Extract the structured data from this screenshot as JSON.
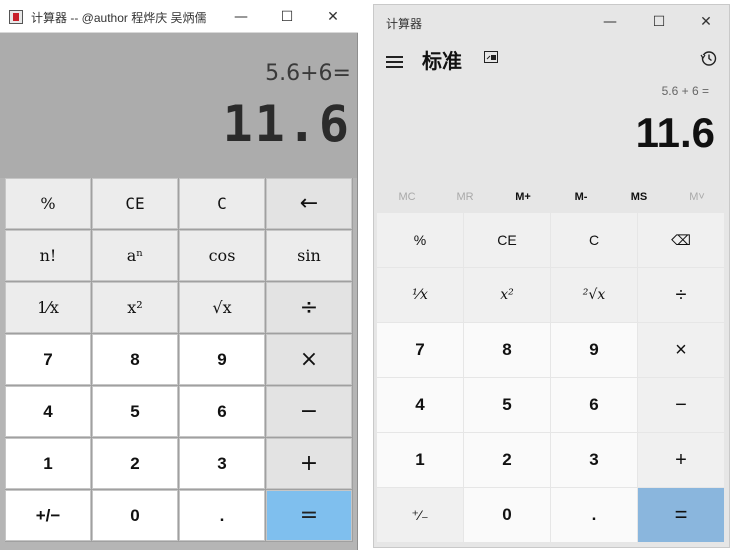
{
  "left_window": {
    "title": "计算器 -- @author 程烨庆 吴炳儒",
    "display": {
      "expression": "5.6+6=",
      "result": "11.6"
    },
    "buttons": [
      {
        "label": "%",
        "kind": "func"
      },
      {
        "label": "CE",
        "kind": "mono"
      },
      {
        "label": "C",
        "kind": "mono"
      },
      {
        "label": "←",
        "kind": "op"
      },
      {
        "label": "n!",
        "kind": "func"
      },
      {
        "label": "aⁿ",
        "kind": "func"
      },
      {
        "label": "cos",
        "kind": "func"
      },
      {
        "label": "sin",
        "kind": "func"
      },
      {
        "label": "1⁄x",
        "kind": "func"
      },
      {
        "label": "x²",
        "kind": "func"
      },
      {
        "label": "√x",
        "kind": "func"
      },
      {
        "label": "÷",
        "kind": "op"
      },
      {
        "label": "7",
        "kind": "num"
      },
      {
        "label": "8",
        "kind": "num"
      },
      {
        "label": "9",
        "kind": "num"
      },
      {
        "label": "×",
        "kind": "op"
      },
      {
        "label": "4",
        "kind": "num"
      },
      {
        "label": "5",
        "kind": "num"
      },
      {
        "label": "6",
        "kind": "num"
      },
      {
        "label": "−",
        "kind": "op"
      },
      {
        "label": "1",
        "kind": "num"
      },
      {
        "label": "2",
        "kind": "num"
      },
      {
        "label": "3",
        "kind": "num"
      },
      {
        "label": "+",
        "kind": "op"
      },
      {
        "label": "+/−",
        "kind": "num"
      },
      {
        "label": "0",
        "kind": "num"
      },
      {
        "label": ".",
        "kind": "num"
      },
      {
        "label": "=",
        "kind": "eq"
      }
    ]
  },
  "right_window": {
    "title": "计算器",
    "mode": "标准",
    "display": {
      "expression": "5.6 + 6 =",
      "result": "11.6"
    },
    "memory": [
      {
        "label": "MC",
        "disabled": true
      },
      {
        "label": "MR",
        "disabled": true
      },
      {
        "label": "M+",
        "disabled": false
      },
      {
        "label": "M-",
        "disabled": false
      },
      {
        "label": "MS",
        "disabled": false
      },
      {
        "label": "M˅",
        "disabled": true
      }
    ],
    "buttons": [
      {
        "label": "%",
        "kind": "op-small"
      },
      {
        "label": "CE",
        "kind": "plain"
      },
      {
        "label": "C",
        "kind": "plain"
      },
      {
        "label": "⌫",
        "kind": "plain"
      },
      {
        "label": "¹⁄x",
        "kind": "italic"
      },
      {
        "label": "x²",
        "kind": "italic"
      },
      {
        "label": "²√x",
        "kind": "italic"
      },
      {
        "label": "÷",
        "kind": "op"
      },
      {
        "label": "7",
        "kind": "num"
      },
      {
        "label": "8",
        "kind": "num"
      },
      {
        "label": "9",
        "kind": "num"
      },
      {
        "label": "×",
        "kind": "op"
      },
      {
        "label": "4",
        "kind": "num"
      },
      {
        "label": "5",
        "kind": "num"
      },
      {
        "label": "6",
        "kind": "num"
      },
      {
        "label": "−",
        "kind": "op"
      },
      {
        "label": "1",
        "kind": "num"
      },
      {
        "label": "2",
        "kind": "num"
      },
      {
        "label": "3",
        "kind": "num"
      },
      {
        "label": "+",
        "kind": "op"
      },
      {
        "label": "⁺⁄₋",
        "kind": "plain"
      },
      {
        "label": "0",
        "kind": "num"
      },
      {
        "label": ".",
        "kind": "num"
      },
      {
        "label": "=",
        "kind": "eq"
      }
    ]
  },
  "window_controls": {
    "minimize": "—",
    "maximize": "☐",
    "close": "✕"
  }
}
